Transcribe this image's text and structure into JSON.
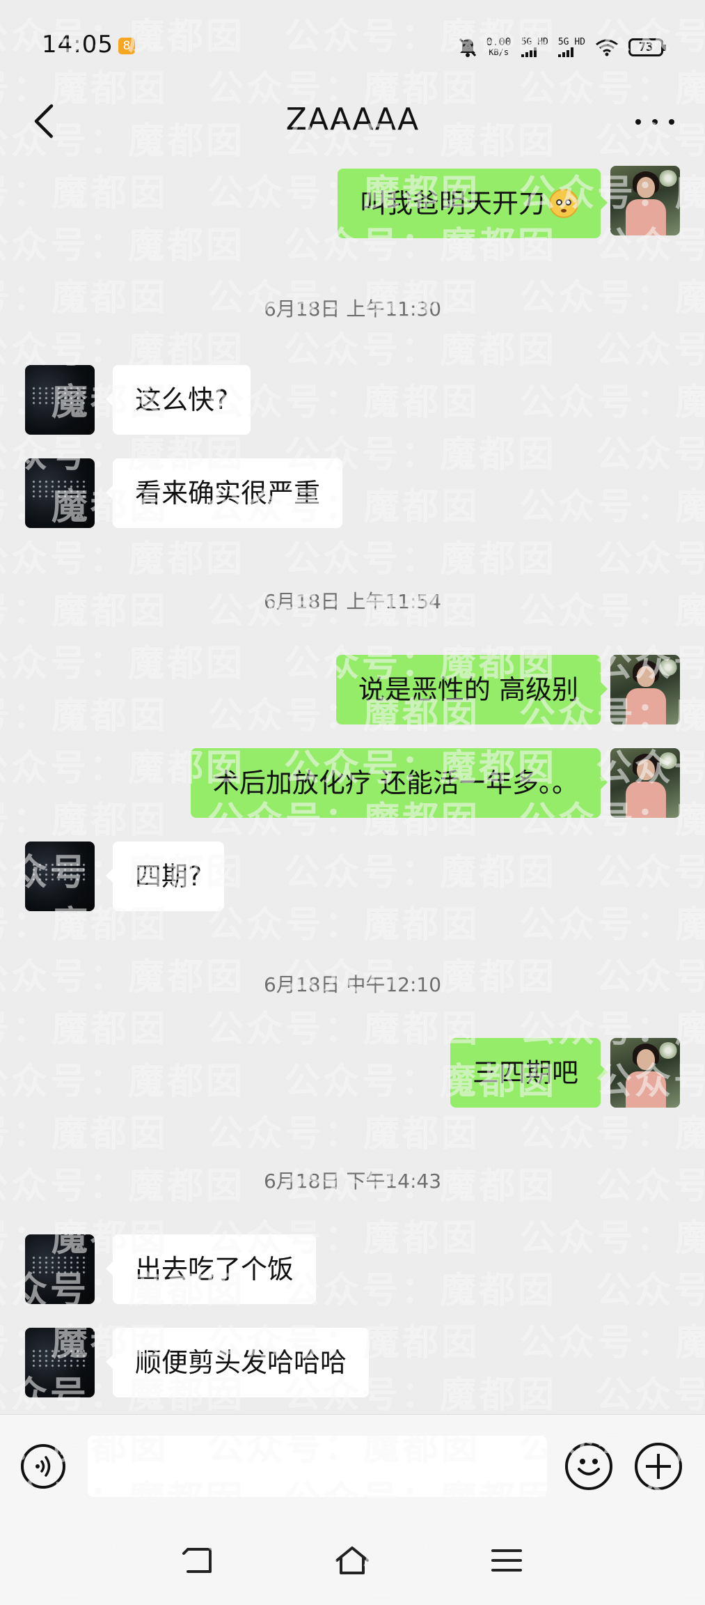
{
  "status_bar": {
    "time": "14:05",
    "app_badge": "8",
    "net_speed_value": "0.00",
    "net_speed_unit": "KB/s",
    "signal_1_label": "5G HD",
    "signal_2_label": "5G HD",
    "battery_level": "73",
    "icons": [
      "notifications-muted-icon",
      "signal-icon",
      "wifi-icon",
      "battery-icon"
    ]
  },
  "header": {
    "title": "ZAAAAA",
    "back_icon": "chevron-left-icon",
    "more_icon": "more-dots-icon"
  },
  "messages": [
    {
      "type": "message",
      "side": "right",
      "text": "叫我爸明天开刀",
      "emoji": "flushed-face-emoji"
    },
    {
      "type": "timestamp",
      "text": "6月18日 上午11:30"
    },
    {
      "type": "message",
      "side": "left",
      "text": "这么快?"
    },
    {
      "type": "message",
      "side": "left",
      "text": "看来确实很严重"
    },
    {
      "type": "timestamp",
      "text": "6月18日 上午11:54"
    },
    {
      "type": "message",
      "side": "right",
      "text": "说是恶性的 高级别"
    },
    {
      "type": "message",
      "side": "right",
      "text": "术后加放化疗 还能活一年多。。"
    },
    {
      "type": "message",
      "side": "left",
      "text": "四期?"
    },
    {
      "type": "timestamp",
      "text": "6月18日 中午12:10"
    },
    {
      "type": "message",
      "side": "right",
      "text": "三四期吧"
    },
    {
      "type": "timestamp",
      "text": "6月18日 下午14:43"
    },
    {
      "type": "message",
      "side": "left",
      "text": "出去吃了个饭"
    },
    {
      "type": "message",
      "side": "left",
      "text": "顺便剪头发哈哈哈"
    }
  ],
  "input_bar": {
    "value": "",
    "voice_icon": "voice-icon",
    "emoji_icon": "emoji-icon",
    "plus_icon": "plus-icon"
  },
  "nav_bar": {
    "icons": [
      "back-icon",
      "home-icon",
      "menu-icon"
    ]
  },
  "watermark": {
    "text": "公众号：魔都囡"
  },
  "colors": {
    "background": "#ededed",
    "sent_bubble": "#95ec69",
    "received_bubble": "#ffffff",
    "timestamp_text": "#6e6e6e"
  }
}
